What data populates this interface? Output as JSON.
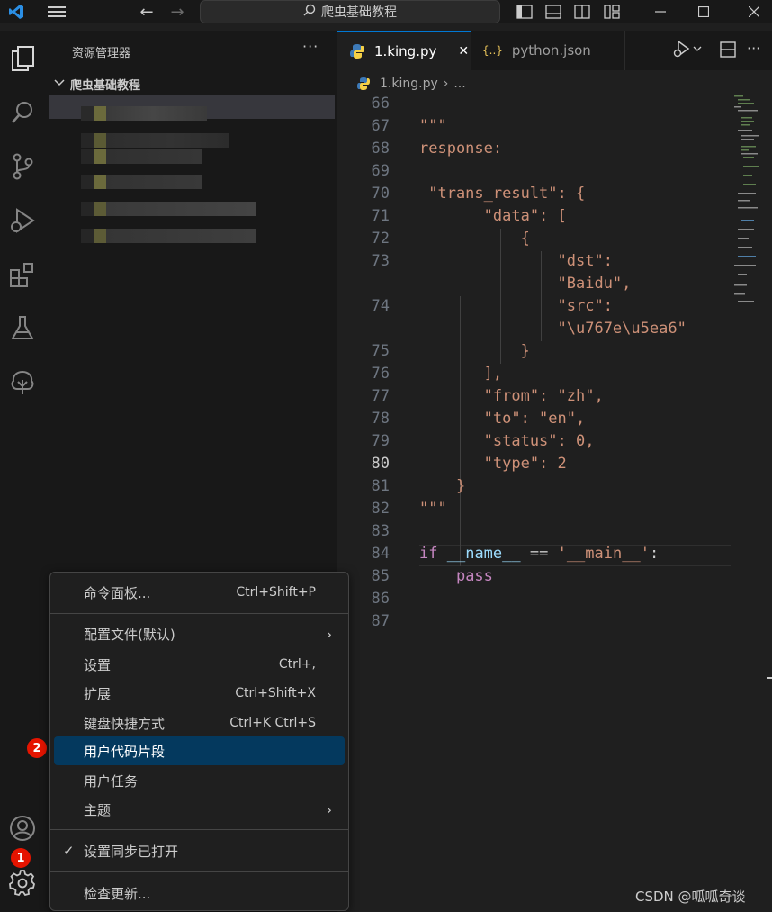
{
  "titlebar": {
    "search_text": "爬虫基础教程"
  },
  "sidebar": {
    "title": "资源管理器",
    "more": "···",
    "folder": "爬虫基础教程"
  },
  "tabs": [
    {
      "label": "1.king.py",
      "close": "✕"
    },
    {
      "label": "python.json",
      "icon_text": "{..}"
    }
  ],
  "breadcrumb": {
    "file": "1.king.py",
    "rest": "..."
  },
  "code": {
    "lines": [
      {
        "n": "66",
        "t": ""
      },
      {
        "n": "67",
        "t": "\"\"\""
      },
      {
        "n": "68",
        "t": "response:"
      },
      {
        "n": "69",
        "t": ""
      },
      {
        "n": "70",
        "t": " \"trans_result\": {"
      },
      {
        "n": "71",
        "t": "       \"data\": ["
      },
      {
        "n": "72",
        "t": "           {"
      },
      {
        "n": "73",
        "t": "               \"dst\":"
      },
      {
        "n": "",
        "t": "               \"Baidu\","
      },
      {
        "n": "74",
        "t": "               \"src\":"
      },
      {
        "n": "",
        "t": "               \"\\u767e\\u5ea6\""
      },
      {
        "n": "75",
        "t": "           }"
      },
      {
        "n": "76",
        "t": "       ],"
      },
      {
        "n": "77",
        "t": "       \"from\": \"zh\","
      },
      {
        "n": "78",
        "t": "       \"to\": \"en\","
      },
      {
        "n": "79",
        "t": "       \"status\": 0,"
      },
      {
        "n": "80",
        "t": "       \"type\": 2"
      },
      {
        "n": "81",
        "t": "    }"
      },
      {
        "n": "82",
        "t": "\"\"\""
      },
      {
        "n": "83",
        "t": ""
      },
      {
        "n": "84",
        "t": "if __name__ == '__main__':"
      },
      {
        "n": "85",
        "t": "    pass"
      },
      {
        "n": "86",
        "t": ""
      },
      {
        "n": "87",
        "t": ""
      }
    ]
  },
  "menu": {
    "items": [
      {
        "label": "命令面板...",
        "key": "Ctrl+Shift+P"
      },
      {
        "label": "配置文件(默认)",
        "arrow": "›"
      },
      {
        "label": "设置",
        "key": "Ctrl+,"
      },
      {
        "label": "扩展",
        "key": "Ctrl+Shift+X"
      },
      {
        "label": "键盘快捷方式",
        "key": "Ctrl+K Ctrl+S"
      },
      {
        "label": "用户代码片段"
      },
      {
        "label": "用户任务"
      },
      {
        "label": "主题",
        "arrow": "›"
      },
      {
        "label": "设置同步已打开",
        "check": "✓"
      },
      {
        "label": "检查更新..."
      }
    ]
  },
  "badges": {
    "one": "1",
    "two": "2"
  },
  "watermark": "CSDN @呱呱奇谈",
  "colors": {
    "accent": "#0078d4",
    "selected_menu": "#04395e",
    "badge": "#e51400",
    "string": "#ce9178",
    "keyword": "#c586c0",
    "variable": "#9cdcfe"
  }
}
